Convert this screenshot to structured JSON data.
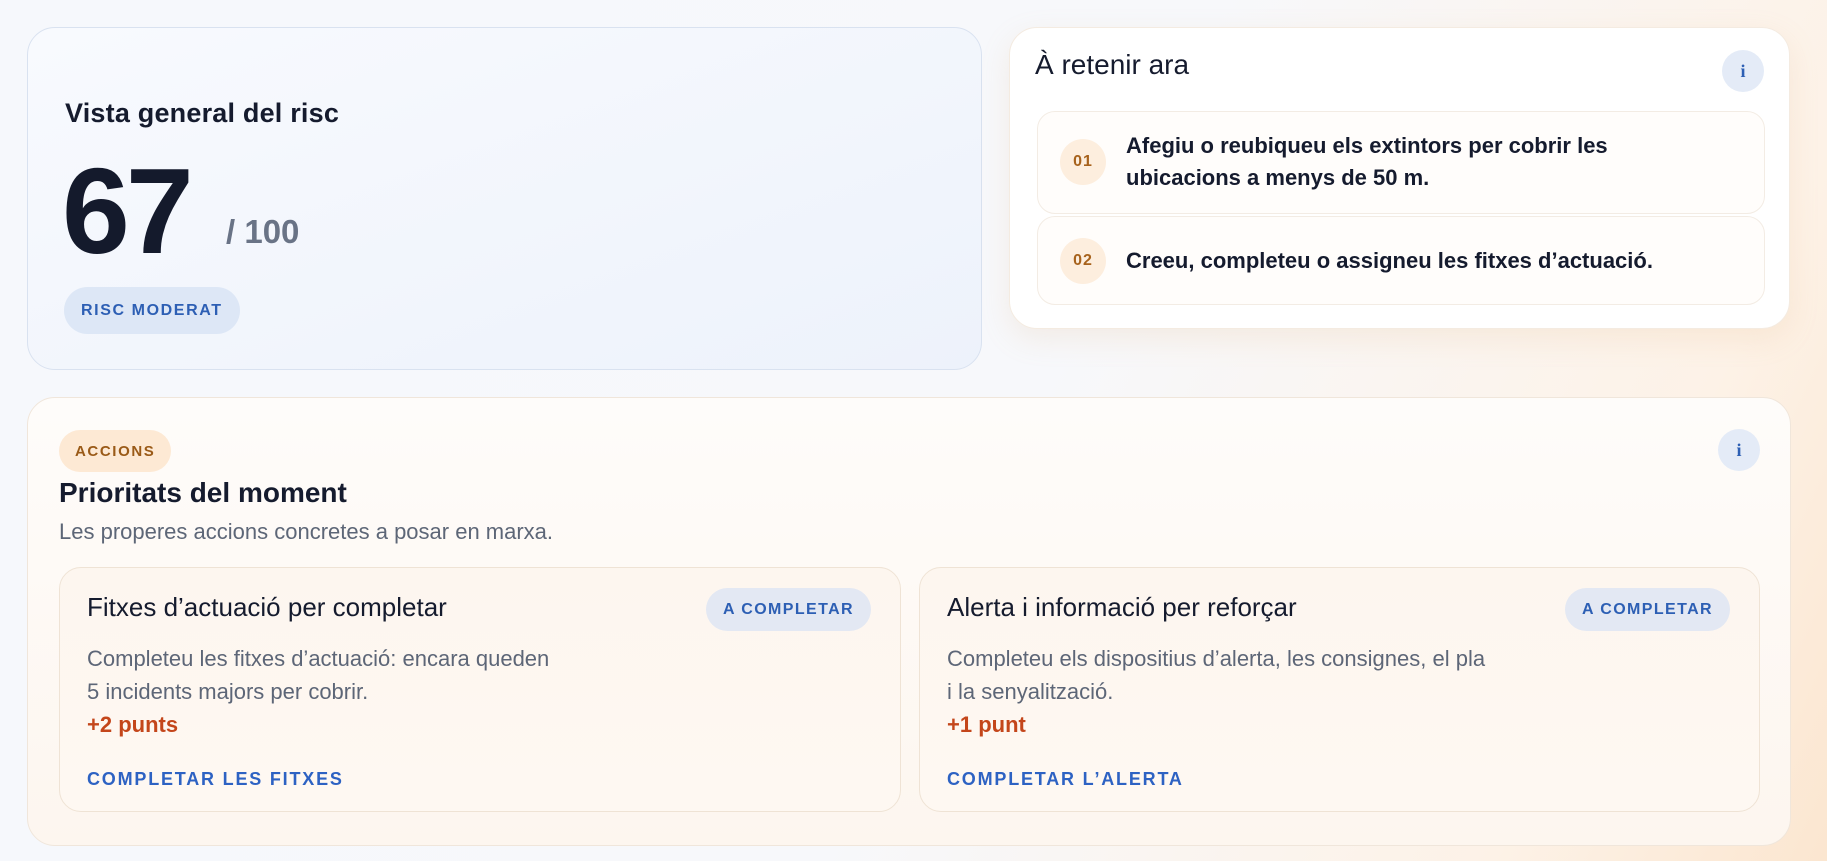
{
  "risk": {
    "title": "Vista general del risc",
    "score": "67",
    "max": "/ 100",
    "badge": "RISC MODERAT"
  },
  "takeaways": {
    "title": "À retenir ara",
    "info_label": "i",
    "items": [
      {
        "num": "01",
        "text": "Afegiu o reubiqueu els extintors per cobrir les ubicacions a menys de 50 m."
      },
      {
        "num": "02",
        "text": "Creeu, completeu o assigneu les fitxes d’actuació."
      }
    ]
  },
  "actions": {
    "pill": "ACCIONS",
    "info_label": "i",
    "title": "Prioritats del moment",
    "subtitle": "Les properes accions concretes a posar en marxa.",
    "cards": [
      {
        "title": "Fitxes d’actuació per completar",
        "badge": "A COMPLETAR",
        "desc_line1": "Completeu les fitxes d’actuació: encara queden",
        "desc_line2": "5 incidents majors per cobrir.",
        "points": "+2 punts",
        "link": "COMPLETAR LES FITXES"
      },
      {
        "title": "Alerta i informació per reforçar",
        "badge": "A COMPLETAR",
        "desc_line1": "Completeu els dispositius d’alerta, les consignes, el pla",
        "desc_line2": "i la senyalització.",
        "points": "+1 punt",
        "link": "COMPLETAR L’ALERTA"
      }
    ]
  },
  "colors": {
    "accent_blue": "#2d62c3",
    "accent_orange": "#c4461b",
    "badge_orange_bg": "#fde9d4",
    "badge_blue_bg": "#dde7f6"
  }
}
